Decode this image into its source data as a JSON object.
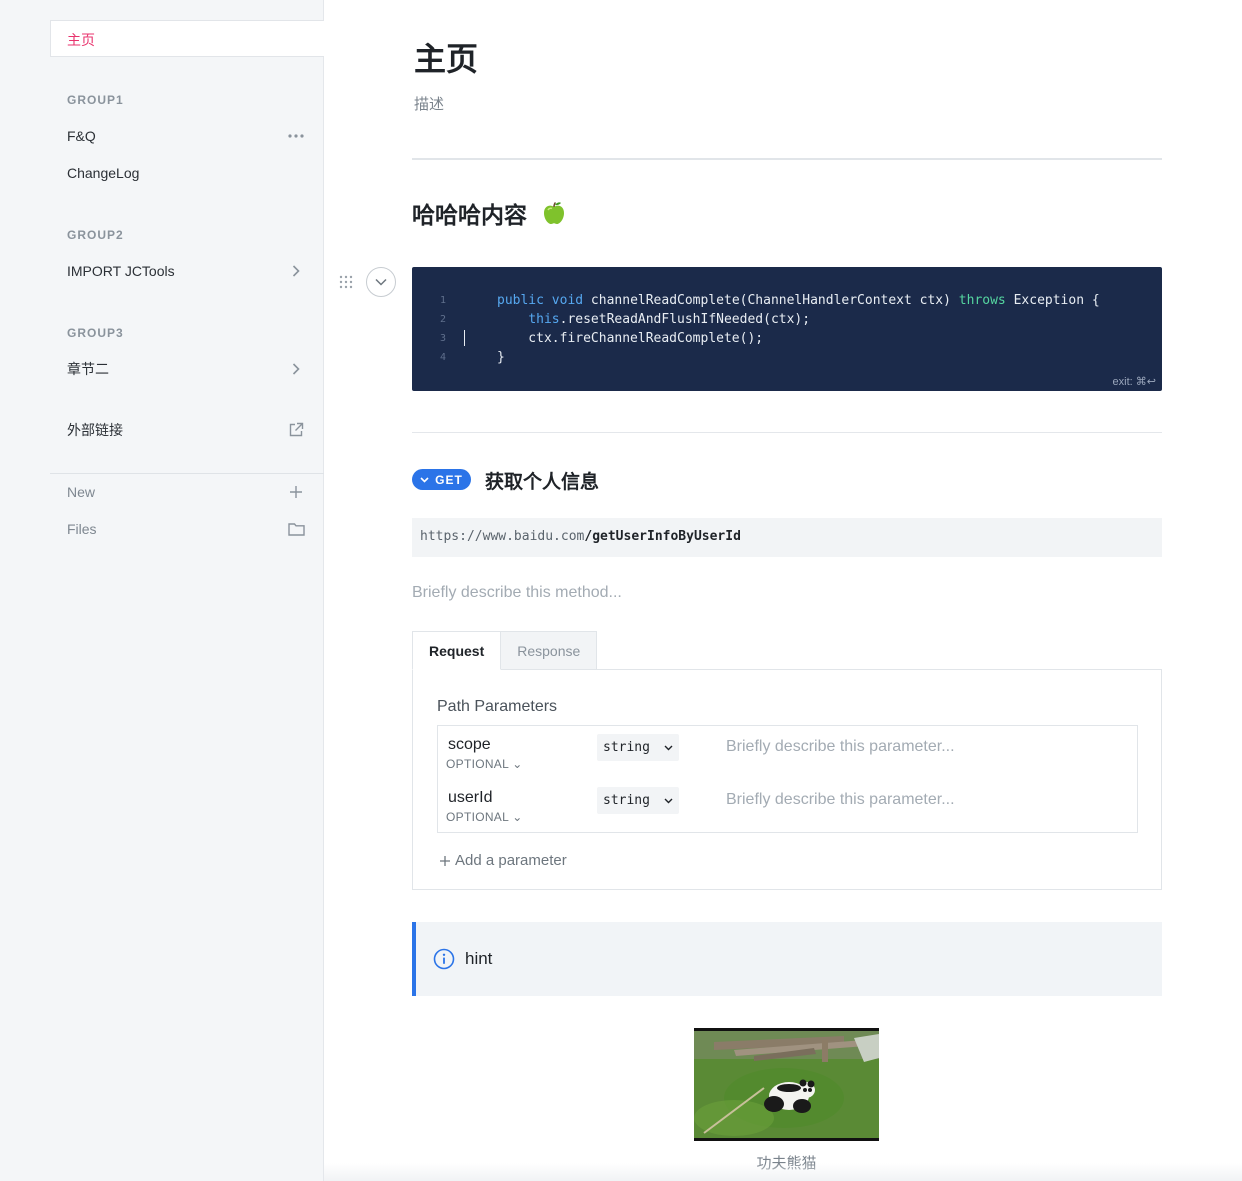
{
  "sidebar": {
    "home": "主页",
    "groups": [
      {
        "title": "GROUP1",
        "items": [
          {
            "label": "F&Q",
            "icon": "more-icon"
          },
          {
            "label": "ChangeLog"
          }
        ]
      },
      {
        "title": "GROUP2",
        "items": [
          {
            "label": "IMPORT JCTools",
            "icon": "chevron-right-icon"
          }
        ]
      },
      {
        "title": "GROUP3",
        "items": [
          {
            "label": "章节二",
            "icon": "chevron-right-icon"
          }
        ]
      }
    ],
    "external_link": "外部链接",
    "new_label": "New",
    "files_label": "Files"
  },
  "page": {
    "title": "主页",
    "description": "描述",
    "section_heading": "哈哈哈内容"
  },
  "code_block": {
    "line_numbers": [
      "1",
      "2",
      "3",
      "4"
    ],
    "lines": [
      {
        "parts": [
          "",
          "public",
          " ",
          "void",
          " channelReadComplete(ChannelHandlerContext ctx) ",
          "throws",
          " Exception {"
        ]
      },
      {
        "parts": [
          "    ",
          "this",
          ".resetReadAndFlushIfNeeded(ctx);"
        ]
      },
      {
        "parts": [
          "    ctx.fireChannelReadComplete();"
        ]
      },
      {
        "parts": [
          "}"
        ]
      }
    ],
    "exit_hint": "exit: ⌘↩"
  },
  "api": {
    "method": "GET",
    "title": "获取个人信息",
    "base_url": "https://www.baidu.com",
    "path": "/getUserInfoByUserId",
    "description_placeholder": "Briefly describe this method...",
    "tabs": [
      "Request",
      "Response"
    ],
    "active_tab": "Request",
    "path_parameters_title": "Path Parameters",
    "params": [
      {
        "name": "scope",
        "required": "OPTIONAL",
        "type": "string",
        "description_placeholder": "Briefly describe this parameter..."
      },
      {
        "name": "userId",
        "required": "OPTIONAL",
        "type": "string",
        "description_placeholder": "Briefly describe this parameter..."
      }
    ],
    "add_param_label": "Add a parameter"
  },
  "hint": {
    "text": "hint"
  },
  "image": {
    "caption": "功夫熊猫"
  },
  "colors": {
    "accent": "#2b74e8",
    "home_active": "#e8336d",
    "code_bg": "#1b2a4a"
  }
}
